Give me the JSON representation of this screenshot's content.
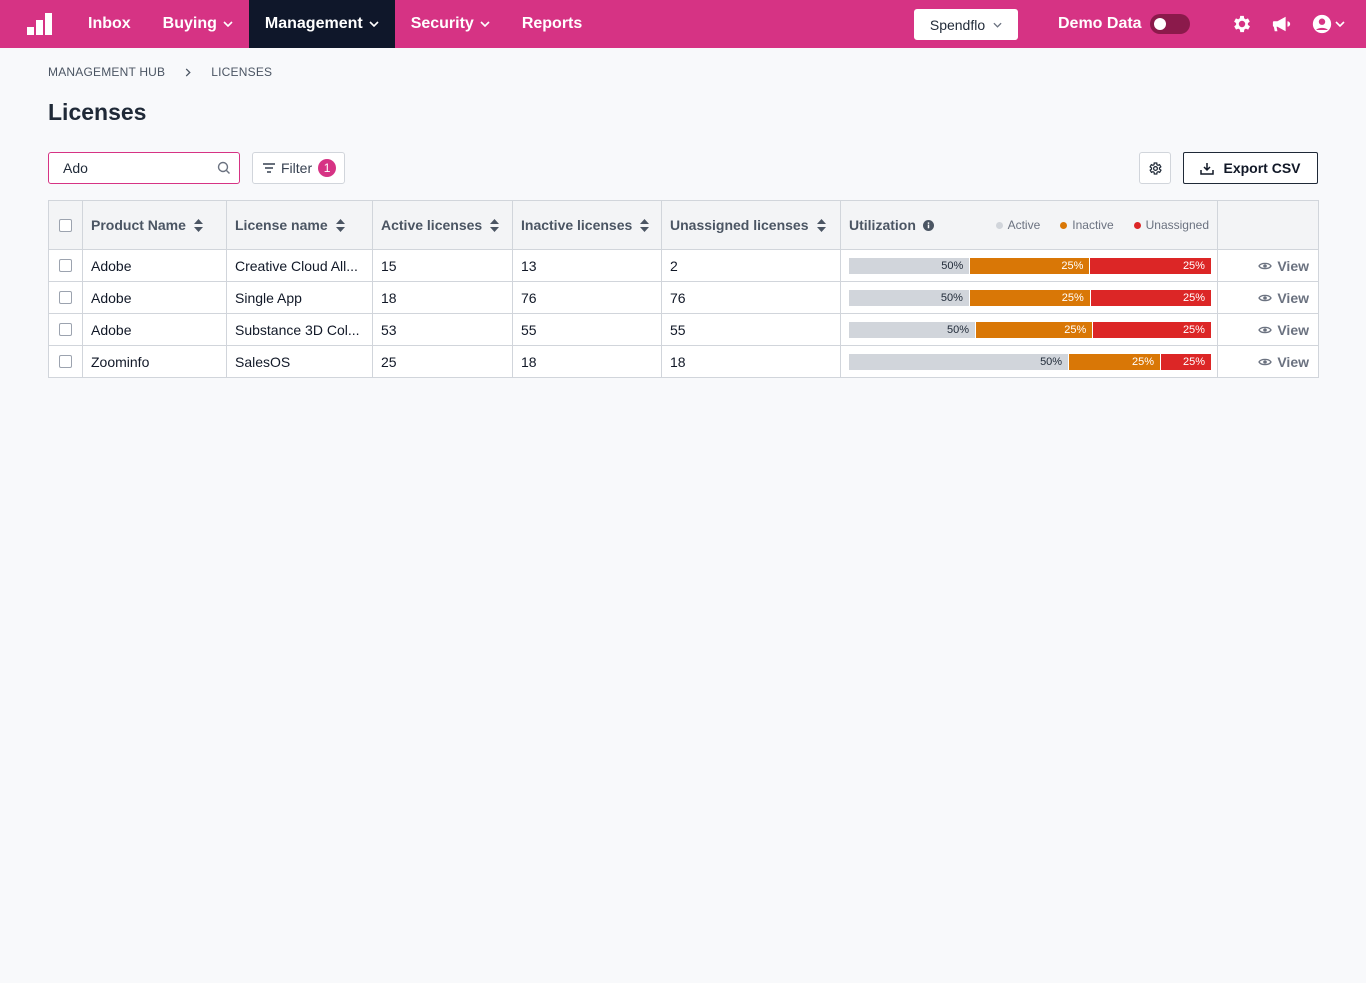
{
  "nav": {
    "items": [
      {
        "label": "Inbox",
        "has_menu": false,
        "active": false
      },
      {
        "label": "Buying",
        "has_menu": true,
        "active": false
      },
      {
        "label": "Management",
        "has_menu": true,
        "active": true
      },
      {
        "label": "Security",
        "has_menu": true,
        "active": false
      },
      {
        "label": "Reports",
        "has_menu": false,
        "active": false
      }
    ],
    "workspace": "Spendflo",
    "demo_label": "Demo Data",
    "demo_enabled": false
  },
  "breadcrumb": [
    "MANAGEMENT HUB",
    "LICENSES"
  ],
  "page_title": "Licenses",
  "toolbar": {
    "search_value": "Ado",
    "filter_label": "Filter",
    "filter_count": "1",
    "export_label": "Export CSV"
  },
  "table": {
    "headers": {
      "product": "Product Name",
      "license": "License name",
      "active": "Active licenses",
      "inactive": "Inactive licenses",
      "unassigned": "Unassigned licenses",
      "utilization": "Utilization"
    },
    "legend": [
      "Active",
      "Inactive",
      "Unassigned"
    ],
    "view_label": "View",
    "rows": [
      {
        "product": "Adobe",
        "license": "Creative Cloud All...",
        "active": "15",
        "inactive": "13",
        "unassigned": "2",
        "util": [
          {
            "label": "50%",
            "value": 33.5
          },
          {
            "label": "25%",
            "value": 33.2
          },
          {
            "label": "25%",
            "value": 33.3
          }
        ]
      },
      {
        "product": "Adobe",
        "license": "Single App",
        "active": "18",
        "inactive": "76",
        "unassigned": "76",
        "util": [
          {
            "label": "50%",
            "value": 33.4
          },
          {
            "label": "25%",
            "value": 33.4
          },
          {
            "label": "25%",
            "value": 33.2
          }
        ]
      },
      {
        "product": "Adobe",
        "license": "Substance 3D Col...",
        "active": "53",
        "inactive": "55",
        "unassigned": "55",
        "util": [
          {
            "label": "50%",
            "value": 35.1
          },
          {
            "label": "25%",
            "value": 32.4
          },
          {
            "label": "25%",
            "value": 32.5
          }
        ]
      },
      {
        "product": "Zoominfo",
        "license": "SalesOS",
        "active": "25",
        "inactive": "18",
        "unassigned": "18",
        "util": [
          {
            "label": "50%",
            "value": 60.8
          },
          {
            "label": "25%",
            "value": 25.4
          },
          {
            "label": "25%",
            "value": 13.8
          }
        ]
      }
    ]
  },
  "colors": {
    "brand": "#d63384",
    "nav_active": "#0f172a",
    "active": "#d1d5db",
    "inactive": "#d97706",
    "unassigned": "#dc2626"
  }
}
